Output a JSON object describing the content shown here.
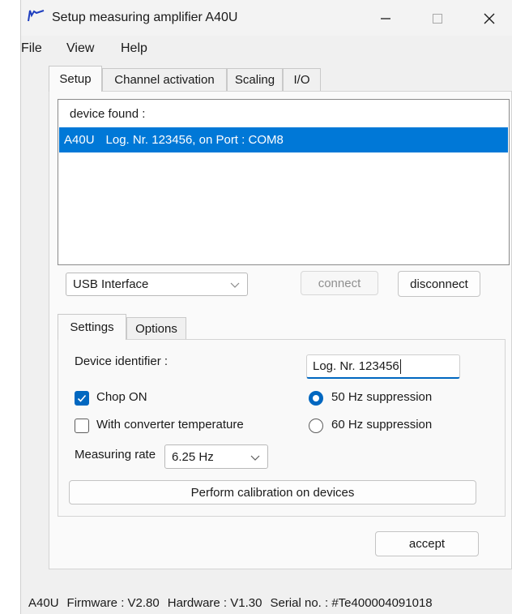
{
  "window": {
    "title": "Setup measuring amplifier A40U"
  },
  "menu": [
    "File",
    "View",
    "Help"
  ],
  "tabs": [
    "Setup",
    "Channel activation",
    "Scaling",
    "I/O"
  ],
  "active_tab": "Setup",
  "device_list": {
    "header": "device found :",
    "rows": [
      {
        "device": "A40U",
        "info": "Log. Nr. 123456, on Port : COM8",
        "selected": true
      }
    ]
  },
  "interface": {
    "selected": "USB Interface"
  },
  "buttons": {
    "connect": "connect",
    "disconnect": "disconnect",
    "calibrate": "Perform calibration on devices",
    "accept": "accept"
  },
  "subtabs": [
    "Settings",
    "Options"
  ],
  "active_subtab": "Settings",
  "settings": {
    "device_identifier_label": "Device identifier :",
    "device_identifier_value": "Log. Nr. 123456",
    "chop_label": "Chop ON",
    "chop_checked": true,
    "conv_temp_label": "With converter temperature",
    "conv_temp_checked": false,
    "measuring_rate_label": "Measuring rate",
    "measuring_rate_value": "6.25 Hz",
    "suppression_50": "50 Hz suppression",
    "suppression_60": "60 Hz suppression",
    "suppression_selected": "50 Hz"
  },
  "status": {
    "device": "A40U",
    "firmware": "Firmware : V2.80",
    "hardware": "Hardware : V1.30",
    "serial": "Serial no. : #Te400004091018"
  },
  "colors": {
    "selection": "#0078d7",
    "accent": "#0067c0",
    "icon": "#1f3fbf"
  }
}
